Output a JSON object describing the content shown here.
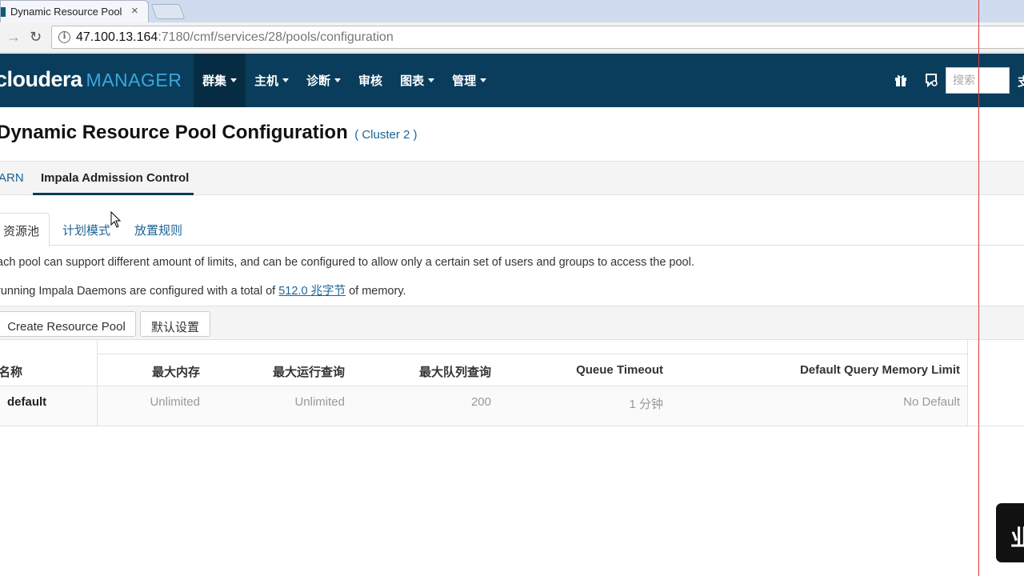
{
  "browser": {
    "tab_title": "Dynamic Resource Pool",
    "tab_close": "×",
    "url_host": "47.100.13.164",
    "url_path": ":7180/cmf/services/28/pools/configuration"
  },
  "header": {
    "logo_main": "cloudera",
    "logo_sub": "MANAGER",
    "nav": [
      {
        "label": "群集",
        "dropdown": true
      },
      {
        "label": "主机",
        "dropdown": true
      },
      {
        "label": "诊断",
        "dropdown": true
      },
      {
        "label": "审核",
        "dropdown": false
      },
      {
        "label": "图表",
        "dropdown": true
      },
      {
        "label": "管理",
        "dropdown": true
      }
    ],
    "search_placeholder": "搜索",
    "cutoff_label": "支"
  },
  "page": {
    "title": "Dynamic Resource Pool Configuration",
    "cluster": "( Cluster 2 )"
  },
  "primary_tabs": {
    "yarn": "ARN",
    "impala": "Impala Admission Control"
  },
  "sub_tabs": {
    "pools": "资源池",
    "plan": "计划模式",
    "placement": "放置规则"
  },
  "description": {
    "line1": "ach pool can support different amount of limits, and can be configured to allow only a certain set of users and groups to access the pool.",
    "line2_prefix": "running Impala Daemons are configured with a total of",
    "memory_link": "512.0 兆字节",
    "line2_suffix": "of memory."
  },
  "toolbar": {
    "create_label": "Create Resource Pool",
    "defaults_label": "默认设置"
  },
  "table": {
    "headers": {
      "name": "名称",
      "max_memory": "最大内存",
      "max_running": "最大运行查询",
      "max_queued": "最大队列查询",
      "queue_timeout": "Queue Timeout",
      "default_mem_limit": "Default Query Memory Limit"
    },
    "rows": [
      {
        "name": "default",
        "max_memory": "Unlimited",
        "max_running": "Unlimited",
        "max_queued": "200",
        "queue_timeout": "1 分钟",
        "default_mem_limit": "No Default"
      }
    ]
  },
  "overlay": {
    "badge_text": "业"
  },
  "colors": {
    "header_bg": "#0a3d5c",
    "header_active": "#062c43",
    "link": "#1a6496",
    "logo_accent": "#3aa7db"
  }
}
